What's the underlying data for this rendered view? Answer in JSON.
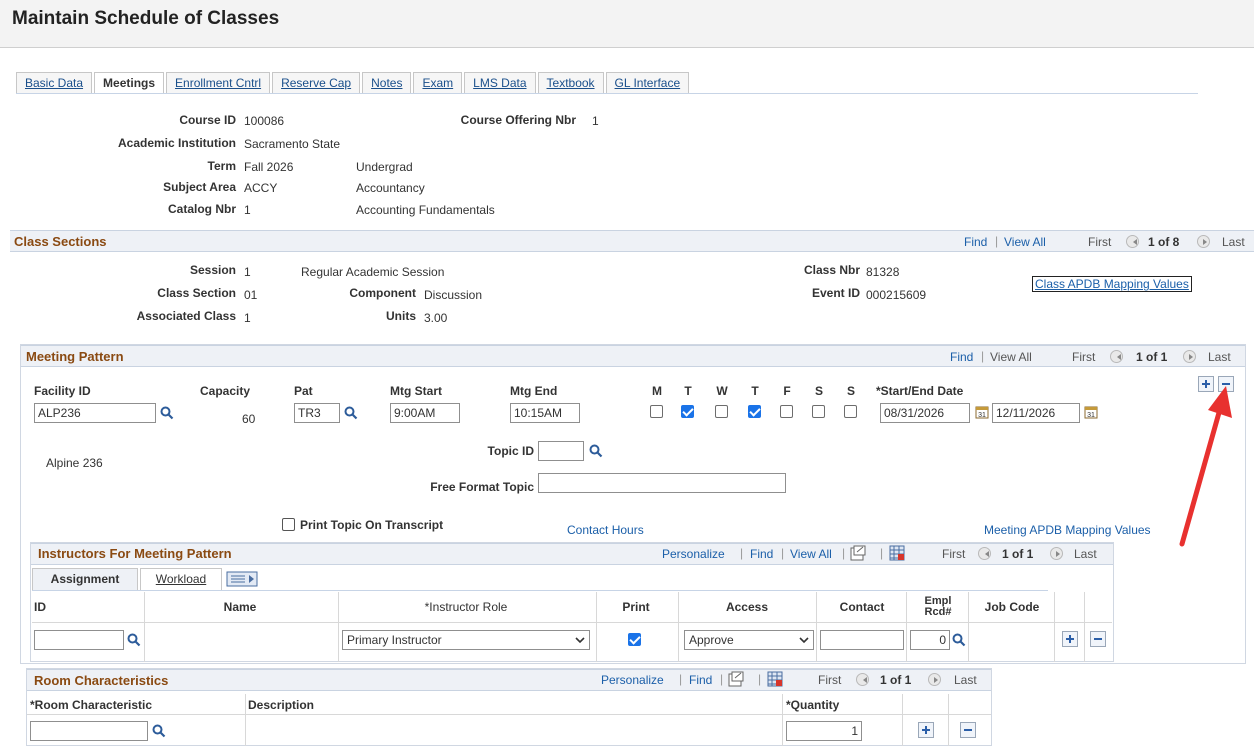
{
  "page": {
    "title": "Maintain Schedule of Classes"
  },
  "tabs": [
    {
      "label": "Basic Data",
      "active": false
    },
    {
      "label": "Meetings",
      "active": true
    },
    {
      "label": "Enrollment Cntrl",
      "active": false
    },
    {
      "label": "Reserve Cap",
      "active": false
    },
    {
      "label": "Notes",
      "active": false
    },
    {
      "label": "Exam",
      "active": false
    },
    {
      "label": "LMS Data",
      "active": false
    },
    {
      "label": "Textbook",
      "active": false
    },
    {
      "label": "GL Interface",
      "active": false
    }
  ],
  "course": {
    "course_id_label": "Course ID",
    "course_id": "100086",
    "offering_label": "Course Offering Nbr",
    "offering": "1",
    "institution_label": "Academic Institution",
    "institution": "Sacramento State",
    "term_label": "Term",
    "term": "Fall 2026",
    "career": "Undergrad",
    "subject_label": "Subject Area",
    "subject": "ACCY",
    "subject_desc": "Accountancy",
    "catalog_label": "Catalog Nbr",
    "catalog": "1",
    "catalog_desc": "Accounting Fundamentals"
  },
  "class_sections": {
    "title": "Class Sections",
    "find": "Find",
    "view_all": "View All",
    "first": "First",
    "counter": "1 of 8",
    "last": "Last",
    "session_label": "Session",
    "session": "1",
    "session_desc": "Regular Academic Session",
    "class_nbr_label": "Class Nbr",
    "class_nbr": "81328",
    "apdb_link": "Class APDB Mapping Values",
    "section_label": "Class Section",
    "section": "01",
    "component_label": "Component",
    "component": "Discussion",
    "event_label": "Event ID",
    "event": "000215609",
    "assoc_label": "Associated Class",
    "assoc": "1",
    "units_label": "Units",
    "units": "3.00"
  },
  "meeting_pattern": {
    "title": "Meeting Pattern",
    "find": "Find",
    "view_all": "View All",
    "first": "First",
    "counter": "1 of 1",
    "last": "Last",
    "facility_label": "Facility ID",
    "facility": "ALP236",
    "facility_desc": "Alpine  236",
    "capacity_label": "Capacity",
    "capacity": "60",
    "pat_label": "Pat",
    "pat": "TR3",
    "start_label": "Mtg Start",
    "start": "9:00AM",
    "end_label": "Mtg End",
    "end": "10:15AM",
    "days": [
      {
        "label": "M",
        "checked": false
      },
      {
        "label": "T",
        "checked": true
      },
      {
        "label": "W",
        "checked": false
      },
      {
        "label": "T",
        "checked": true
      },
      {
        "label": "F",
        "checked": false
      },
      {
        "label": "S",
        "checked": false
      },
      {
        "label": "S",
        "checked": false
      }
    ],
    "date_label": "*Start/End Date",
    "start_date": "08/31/2026",
    "end_date": "12/11/2026",
    "topic_label": "Topic ID",
    "topic": "",
    "free_topic_label": "Free Format Topic",
    "free_topic": "",
    "print_topic_label": "Print Topic On Transcript",
    "contact_hours": "Contact Hours",
    "apdb_link": "Meeting APDB Mapping Values"
  },
  "instructors": {
    "title": "Instructors For Meeting Pattern",
    "personalize": "Personalize",
    "find": "Find",
    "view_all": "View All",
    "first": "First",
    "counter": "1 of 1",
    "last": "Last",
    "subtabs": [
      "Assignment",
      "Workload"
    ],
    "columns": [
      "ID",
      "Name",
      "*Instructor Role",
      "Print",
      "Access",
      "Contact",
      "Empl Rcd#",
      "Job Code"
    ],
    "row": {
      "id": "",
      "name": "",
      "role": "Primary Instructor",
      "print": true,
      "access": "Approve",
      "contact": "",
      "empl_rcd": "0",
      "job_code": ""
    }
  },
  "room": {
    "title": "Room Characteristics",
    "personalize": "Personalize",
    "find": "Find",
    "first": "First",
    "counter": "1 of 1",
    "last": "Last",
    "columns": [
      "*Room Characteristic",
      "Description",
      "*Quantity"
    ],
    "row": {
      "characteristic": "",
      "description": "",
      "quantity": "1"
    }
  },
  "colors": {
    "link": "#1b5fa9",
    "section_title": "#8a4a12",
    "check": "#1a73e8",
    "arrow": "#e8312f"
  }
}
